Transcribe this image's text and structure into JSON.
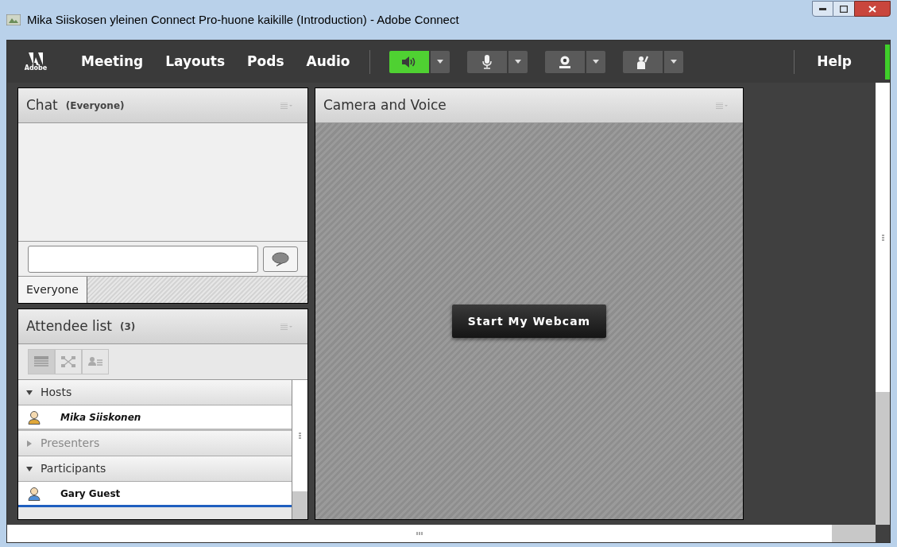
{
  "window": {
    "title": "Mika Siiskosen yleinen Connect Pro-huone kaikille (Introduction) - Adobe Connect"
  },
  "menubar": {
    "logo": "Adobe",
    "menus": [
      "Meeting",
      "Layouts",
      "Pods",
      "Audio"
    ],
    "devices": [
      {
        "kind": "speaker",
        "on": true
      },
      {
        "kind": "microphone",
        "on": false
      },
      {
        "kind": "camera",
        "on": false
      },
      {
        "kind": "raise-hand",
        "on": false
      }
    ],
    "help": "Help"
  },
  "chat": {
    "title": "Chat",
    "subtitle": "(Everyone)",
    "tabs": [
      {
        "label": "Everyone",
        "selected": true
      }
    ]
  },
  "attendees": {
    "title": "Attendee list",
    "count": "(3)",
    "views": [
      {
        "kind": "list",
        "selected": true
      },
      {
        "kind": "network",
        "selected": false
      },
      {
        "kind": "roles",
        "selected": false
      }
    ],
    "groups": [
      {
        "label": "Hosts",
        "expanded": true,
        "children": [
          {
            "name": "Mika Siiskonen",
            "kind": "host",
            "selected": false
          }
        ]
      },
      {
        "label": "Presenters",
        "expanded": false
      },
      {
        "label": "Participants",
        "expanded": true,
        "children": [
          {
            "name": "Gary Guest",
            "kind": "guest",
            "selected": true
          }
        ]
      }
    ]
  },
  "camera": {
    "title": "Camera and Voice",
    "button": "Start My Webcam"
  }
}
